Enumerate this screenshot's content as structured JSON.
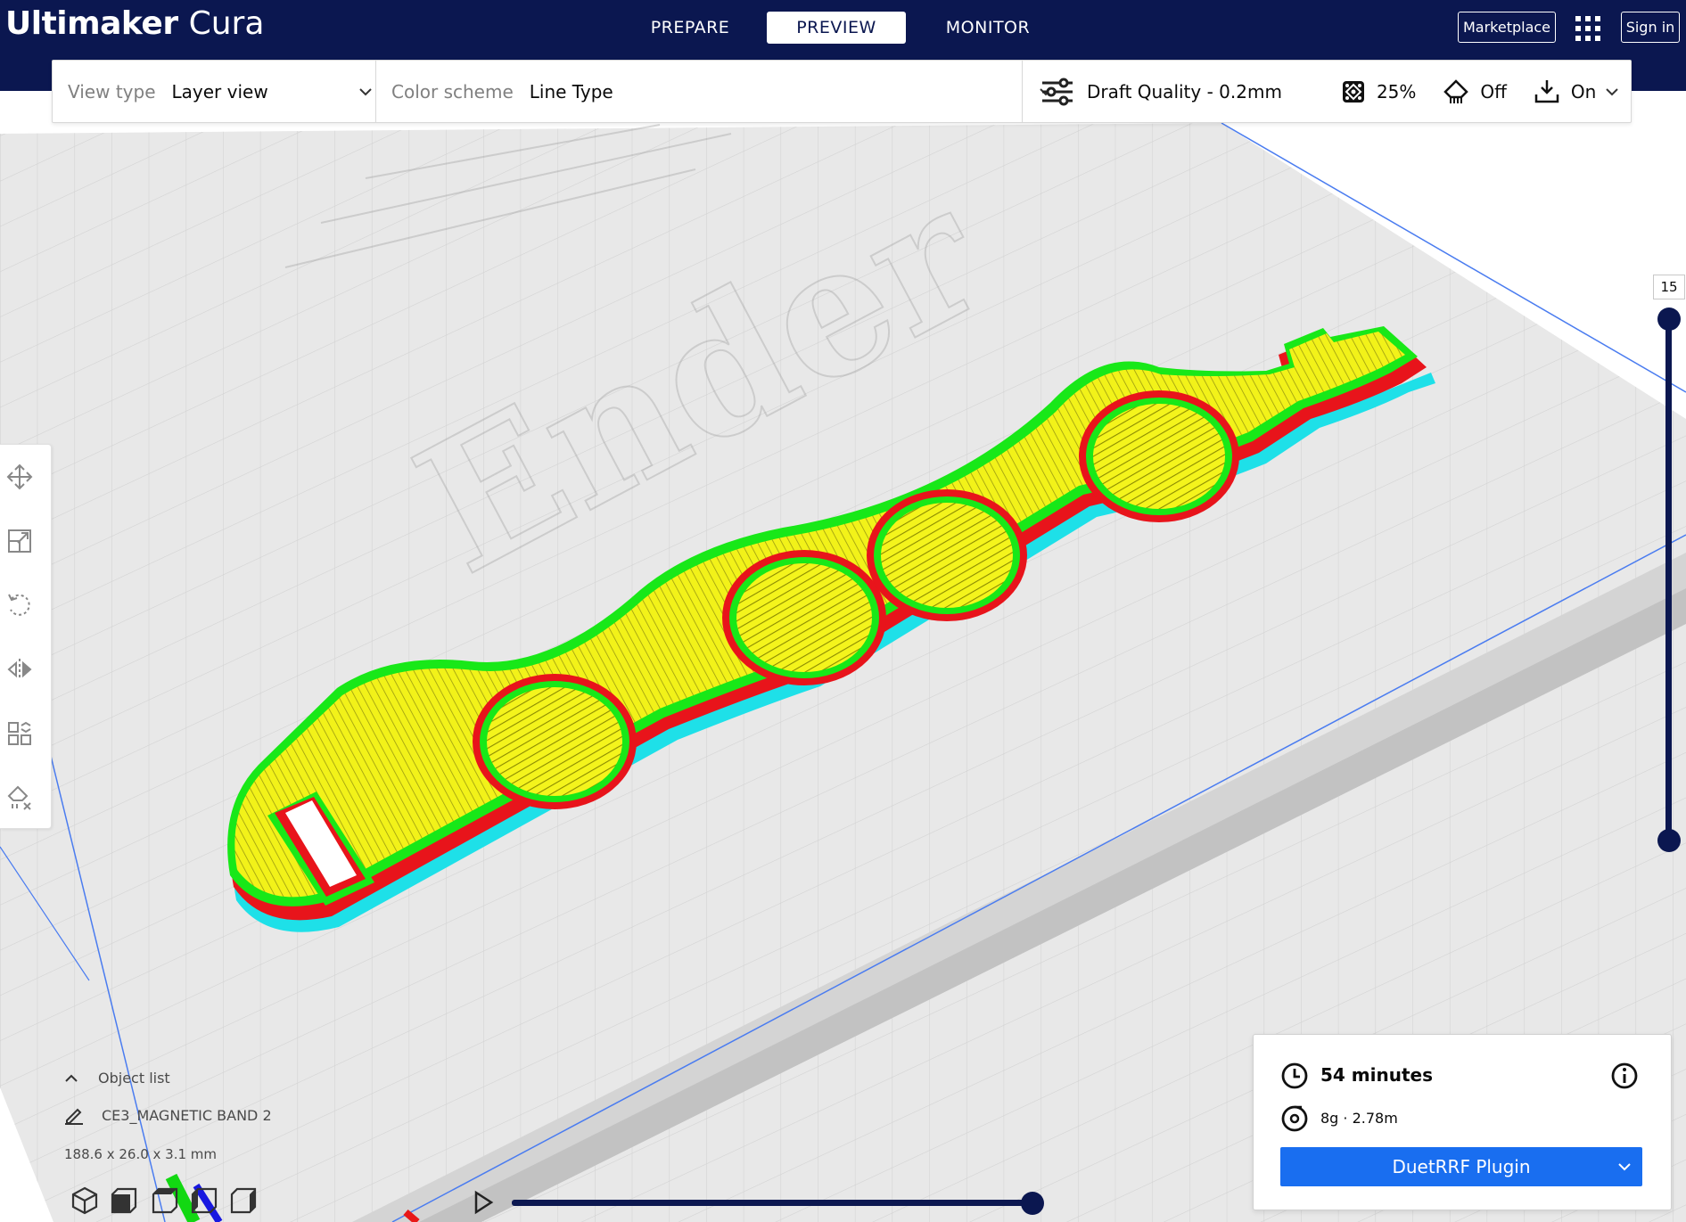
{
  "app": {
    "brand_bold": "Ultimaker",
    "brand_light": "Cura"
  },
  "header": {
    "stages": [
      {
        "label": "PREPARE",
        "active": false
      },
      {
        "label": "PREVIEW",
        "active": true
      },
      {
        "label": "MONITOR",
        "active": false
      }
    ],
    "marketplace_label": "Marketplace",
    "apps_icon": "grid-apps-icon",
    "signin_label": "Sign in"
  },
  "toolbar": {
    "view_type_label": "View type",
    "view_type_value": "Layer view",
    "color_scheme_label": "Color scheme",
    "color_scheme_value": "Line Type",
    "quality_label": "Draft Quality - 0.2mm",
    "infill_value": "25%",
    "support_value": "Off",
    "adhesion_value": "On",
    "icons": {
      "quality": "sliders-icon",
      "infill": "infill-icon",
      "support": "support-icon",
      "adhesion": "adhesion-icon"
    }
  },
  "build_plate": {
    "watermark_text": "Ender",
    "line_type_colors": {
      "outer_wall": "#e8141b",
      "inner_wall": "#18e818",
      "skin": "#f2f219",
      "skirt": "#1ee0e8",
      "support": "#00cfd0"
    }
  },
  "left_tools": [
    {
      "name": "move",
      "icon": "move-icon"
    },
    {
      "name": "scale",
      "icon": "scale-icon"
    },
    {
      "name": "rotate",
      "icon": "rotate-icon"
    },
    {
      "name": "mirror",
      "icon": "mirror-icon"
    },
    {
      "name": "per-model-settings",
      "icon": "per-model-settings-icon"
    },
    {
      "name": "support-blocker",
      "icon": "support-blocker-icon"
    }
  ],
  "layer_slider": {
    "current_layer": "15",
    "layer_level": 1.0
  },
  "object_info": {
    "object_list_label": "Object list",
    "object_name": "CE3_MAGNETIC BAND 2",
    "dimensions": "188.6 x 26.0 x 3.1 mm"
  },
  "view_cube_icons": [
    "3d-view-icon",
    "front-view-icon",
    "top-view-icon",
    "left-view-icon",
    "right-view-icon"
  ],
  "timeline": {
    "progress": 1.0
  },
  "print_panel": {
    "time": "54 minutes",
    "material": "8g · 2.78m",
    "button_label": "DuetRRF Plugin",
    "accent_color": "#196ef0"
  },
  "colors": {
    "header_bg": "#0b1750",
    "accent": "#196ef0"
  }
}
